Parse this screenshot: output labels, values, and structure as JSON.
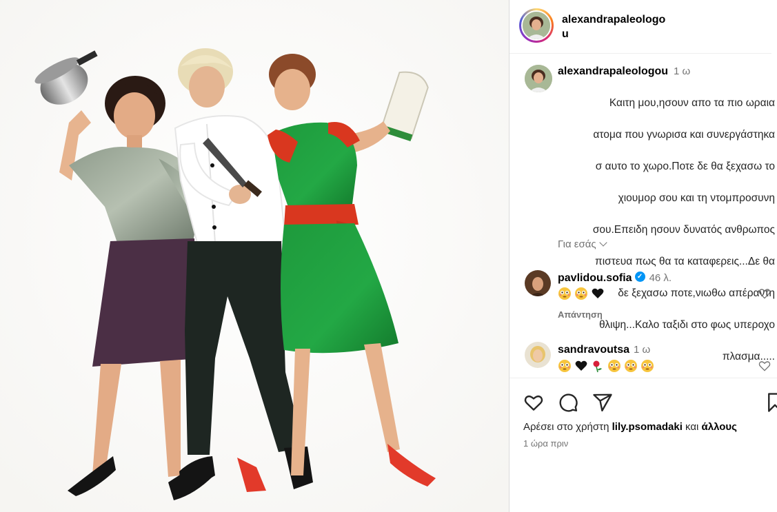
{
  "photo": {
    "description_icon": "post-photo"
  },
  "header": {
    "username_line1": "alexandrapaleologo",
    "username_line2": "u"
  },
  "caption": {
    "username": "alexandrapaleologou",
    "time": "1 ω",
    "lines": [
      "Καιτη μου,ησουν απο τα πιο ωραια",
      "ατομα που γνωρισα και συνεργάστηκα",
      "σ αυτο το χωρο.Ποτε δε θα ξεχασω το",
      "χιουμορ σου και τη ντομπροσυνη",
      "σου.Επειδη ησουν δυνατός ανθρωπος",
      "πιστευα πως θα τα καταφερεις...Δε θα",
      "δε ξεχασω ποτε,νιωθω απέραντη",
      "θλιψη...Καλο ταξιδι στο φως υπεροχο",
      "πλασμα....."
    ],
    "translate_label": "Για εσάς"
  },
  "comments": [
    {
      "username": "pavlidou.sofia",
      "verified": true,
      "time": "46 λ.",
      "emojis": [
        "flushed-face",
        "flushed-face",
        "black-heart"
      ],
      "reply_label": "Απάντηση"
    },
    {
      "username": "sandravoutsa",
      "verified": false,
      "time": "1 ω",
      "emojis": [
        "flushed-face",
        "black-heart",
        "rose",
        "flushed-face",
        "flushed-face",
        "flushed-face"
      ]
    }
  ],
  "actions": {
    "icons": [
      "heart-icon",
      "comment-icon",
      "share-icon",
      "bookmark-icon"
    ]
  },
  "likes": {
    "prefix": "Αρέσει στο χρήστη",
    "user": "lily.psomadaki",
    "middle": "και",
    "others": "άλλους"
  },
  "timestamp": "1 ώρα πριν",
  "colors": {
    "text": "#262626",
    "muted": "#737373",
    "verified": "#0095f6",
    "divider": "#dbdbdb"
  }
}
